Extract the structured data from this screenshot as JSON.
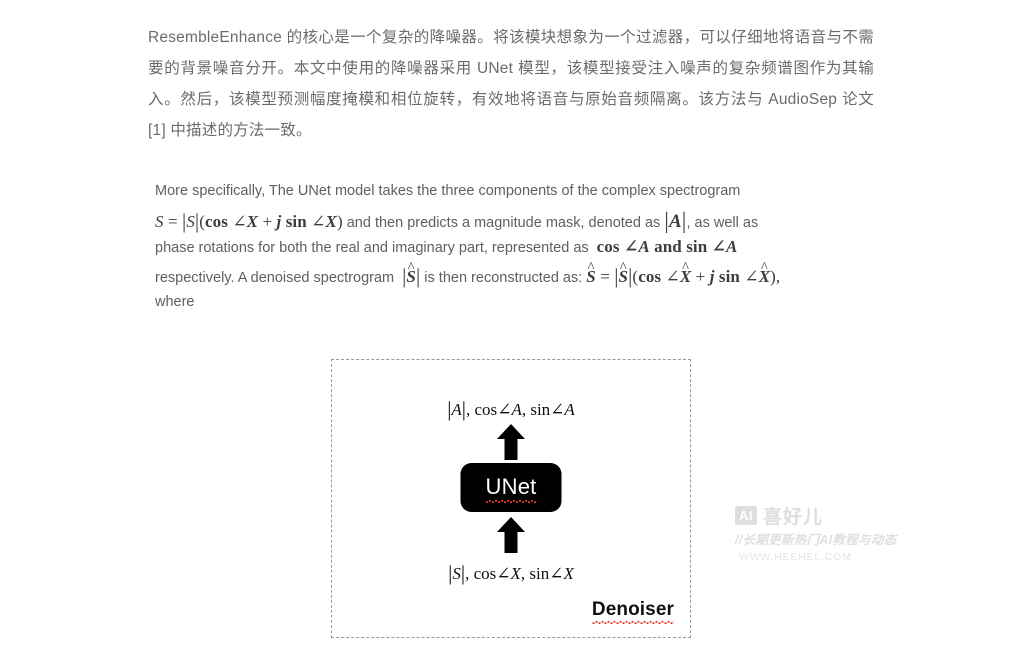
{
  "article": {
    "chinese_paragraph": {
      "full_text": "ResembleEnhance 的核心是一个复杂的降噪器。将该模块想象为一个过滤器，可以仔细地将语音与不需要的背景噪音分开。本文中使用的降噪器采用 UNet 模型，该模型接受注入噪声的复杂频谱图作为其输入。然后，该模型预测幅度掩模和相位旋转，有效地将语音与原始音频隔离。该方法与 AudioSep 论文 [1] 中描述的方法一致。",
      "segments": {
        "lead_term": "ResembleEnhance",
        "part_1": " 的核心是一个复杂的降噪器。将该模块想象为一个过滤器，可以仔细地将语音与不需要的背景噪音分开。本文中使用的降噪器采用 ",
        "model_term": "UNet",
        "part_2": " 模型，该模型接受注入噪声的复杂频谱图作为其输入。然后，该模型预测幅度掩模和相位旋转，有效地将语音与原始音频隔离。该方法与 ",
        "paper_term": "AudioSep",
        "part_3": " 论文 [1] 中描述的方法一致。"
      }
    },
    "english_paragraph": {
      "line1": "More specifically, The UNet model takes the three components of the complex spectrogram",
      "line2_after_formula": "and then predicts a magnitude mask, denoted as",
      "line2_tail": ", as well as",
      "line3_before": "phase rotations for both the real and imaginary part, represented as",
      "line4_before": "respectively. A denoised spectrogram",
      "line4_mid": "is then reconstructed as:",
      "line5": "where",
      "formulas": {
        "input_spectrogram": "S = |S|(cos ∠X + j sin ∠X)",
        "magnitude_mask": "|A|",
        "phase_rotations": "cos ∠A and sin ∠A",
        "denoised_magnitude": "|Ŝ|",
        "denoised_spectrogram": "Ŝ = |Ŝ|(cos ∠X̂ + j sin ∠X̂),"
      }
    }
  },
  "diagram": {
    "container_label": "Denoiser",
    "output_label": "|A| , cos∠A, sin∠A",
    "input_label": "|S| , cos∠X, sin∠X",
    "block_label": "UNet",
    "arrow_direction": "up",
    "border_style": "dashed",
    "block_color": "#000000",
    "block_text_color": "#ffffff",
    "spellcheck_underline_color": "#e23b2e"
  },
  "watermark": {
    "badge": "AI",
    "brand": "喜好儿",
    "tagline": "//长期更新热门AI教程与动态",
    "url": "WWW.HEEHEL.COM",
    "color": "#dedede"
  },
  "colors": {
    "page_background": "#ffffff",
    "body_text": "#6b6b6b",
    "math_text": "#3d3d3d",
    "diagram_border": "#9a9a9a"
  }
}
